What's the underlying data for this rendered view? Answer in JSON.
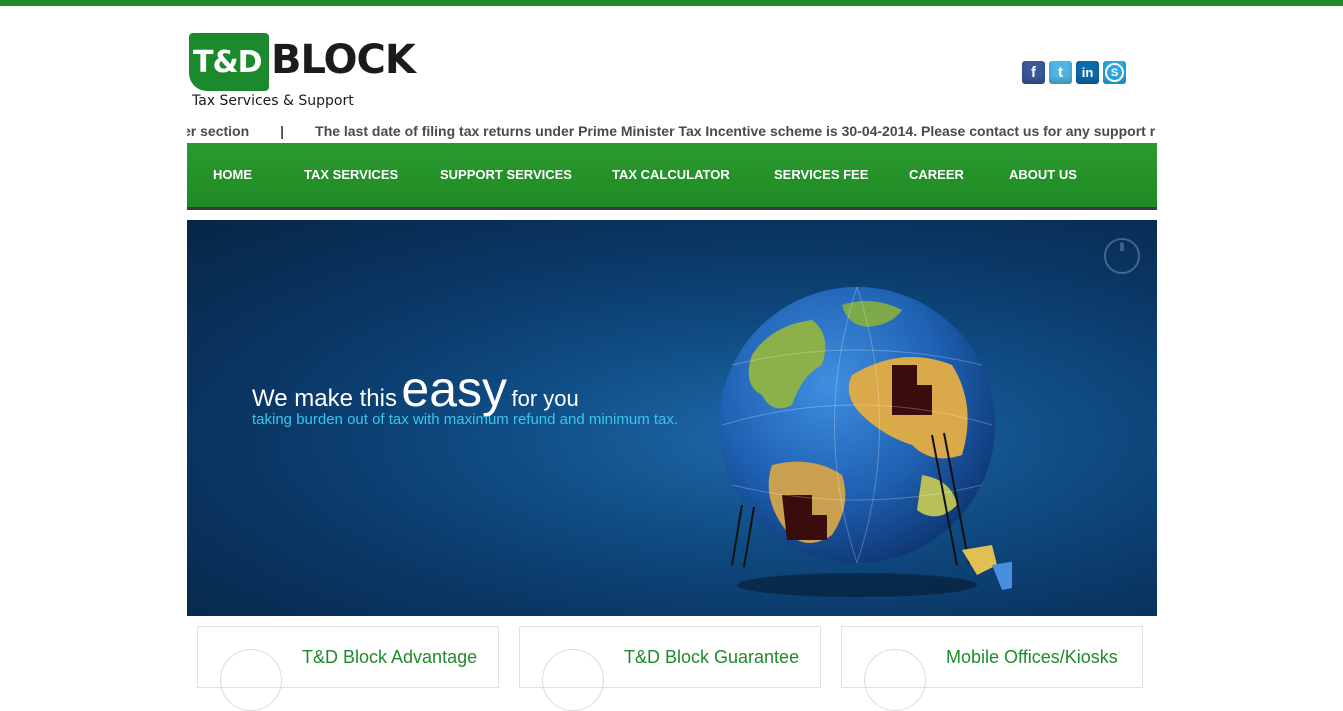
{
  "logo": {
    "mark": "T&D",
    "name": "BLOCK",
    "tagline": "Tax Services & Support"
  },
  "social": [
    {
      "icon": "facebook-icon",
      "glyph": "f",
      "color": "#3b5998"
    },
    {
      "icon": "twitter-icon",
      "glyph": "t",
      "color": "#4fb6e3"
    },
    {
      "icon": "linkedin-icon",
      "glyph": "in",
      "color": "#0e6aa8"
    },
    {
      "icon": "skype-icon",
      "glyph": "S",
      "color": "#2aa7e0"
    }
  ],
  "ticker": {
    "text_a": "er section",
    "separator": "|",
    "text_b": "The last date of filing tax returns under Prime Minister Tax Incentive scheme is 30-04-2014. Please contact us for any support r"
  },
  "nav": {
    "items": [
      "HOME",
      "TAX SERVICES",
      "SUPPORT SERVICES",
      "TAX CALCULATOR",
      "SERVICES FEE",
      "CAREER",
      "ABOUT US"
    ]
  },
  "banner": {
    "line1_start": "We make this",
    "line1_big": "easy",
    "line1_end": "for you",
    "line2": "taking burden out of tax with maximum refund and minimum tax."
  },
  "features": [
    {
      "title": "T&D Block Advantage"
    },
    {
      "title": "T&D Block Guarantee"
    },
    {
      "title": "Mobile Offices/Kiosks"
    }
  ],
  "colors": {
    "brand_green": "#1f8a2a",
    "nav_border": "#3a3a3a",
    "banner_accent": "#39c6ec"
  }
}
